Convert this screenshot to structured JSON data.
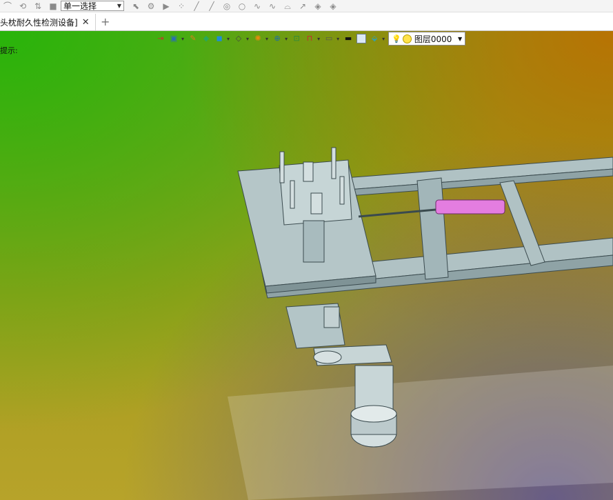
{
  "topbar": {
    "icons": [
      "curve-icon",
      "history-icon",
      "arrows-icon",
      "stop-icon"
    ],
    "select": {
      "value": "单一选择"
    },
    "snap_icons": [
      "cursor-icon",
      "gear-icon",
      "play-icon",
      "dots-icon",
      "line-icon",
      "line-icon",
      "circle-icon",
      "circle-icon",
      "wave-icon",
      "wave-icon",
      "arc-icon",
      "arrow-icon",
      "shape-icon",
      "shape-icon"
    ]
  },
  "tab": {
    "label": "头枕耐久性检测设备]",
    "close": "✕",
    "add": "+"
  },
  "viewport": {
    "hint": "提示:",
    "layer": {
      "value": "图层0000"
    },
    "toolbar_icons": [
      "exit-icon",
      "view-icon",
      "brush-icon",
      "render-icon",
      "cube-icon",
      "cube-outline-icon",
      "wheel-icon",
      "zoom-icon",
      "fit-icon",
      "dimension-icon",
      "monitor-icon",
      "line-style-icon",
      "color-box-icon",
      "layer-shape-icon"
    ]
  },
  "colors": {
    "accent_green": "#2fb40a",
    "accent_orange": "#c16f00",
    "model_gray": "#b0c2c4",
    "cylinder_pink": "#e47de0"
  }
}
